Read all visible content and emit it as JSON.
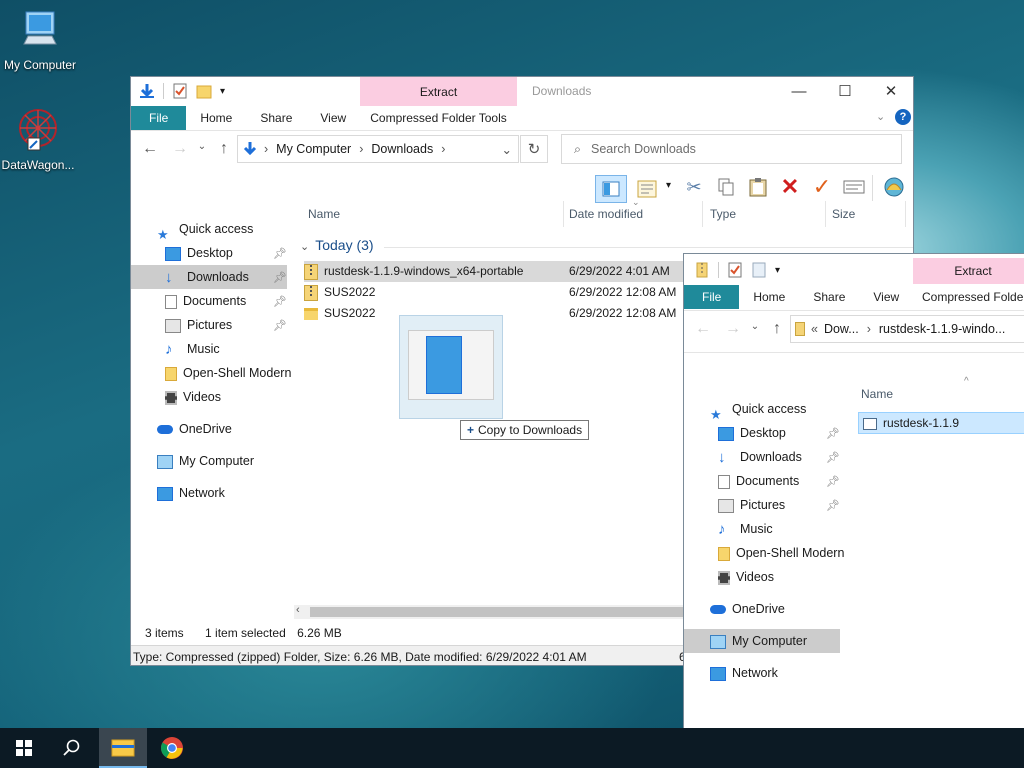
{
  "desktop": {
    "icons": [
      {
        "label": "My Computer"
      },
      {
        "label": "DataWagon..."
      }
    ]
  },
  "main_window": {
    "title_context": "Extract",
    "title_location": "Downloads",
    "tabs": [
      "File",
      "Home",
      "Share",
      "View"
    ],
    "context_tab": "Compressed Folder Tools",
    "address": {
      "root": "My Computer",
      "current": "Downloads"
    },
    "search_placeholder": "Search Downloads",
    "nav": {
      "quick_access": "Quick access",
      "desktop": "Desktop",
      "downloads": "Downloads",
      "documents": "Documents",
      "pictures": "Pictures",
      "music": "Music",
      "openshell": "Open-Shell Modern",
      "videos": "Videos",
      "onedrive": "OneDrive",
      "mycomputer": "My Computer",
      "network": "Network"
    },
    "columns": [
      "Name",
      "Date modified",
      "Type",
      "Size"
    ],
    "group": "Today (3)",
    "files": [
      {
        "name": "rustdesk-1.1.9-windows_x64-portable",
        "date": "6/29/2022 4:01 AM"
      },
      {
        "name": "SUS2022",
        "date": "6/29/2022 12:08 AM"
      },
      {
        "name": "SUS2022",
        "date": "6/29/2022 12:08 AM"
      }
    ],
    "drag_tooltip": "Copy to Downloads",
    "status": {
      "items": "3 items",
      "selected": "1 item selected",
      "size": "6.26 MB"
    },
    "details_bar": "Type: Compressed (zipped) Folder, Size: 6.26 MB, Date modified: 6/29/2022 4:01 AM",
    "details_bar_overflow": "6"
  },
  "second_window": {
    "title_context": "Extract",
    "tabs": [
      "File",
      "Home",
      "Share",
      "View"
    ],
    "context_tab": "Compressed Folder",
    "address": {
      "prefix": "«",
      "part1": "Dow...",
      "part2": "rustdesk-1.1.9-windo..."
    },
    "column": "Name",
    "file": "rustdesk-1.1.9",
    "nav": {
      "quick_access": "Quick access",
      "desktop": "Desktop",
      "downloads": "Downloads",
      "documents": "Documents",
      "pictures": "Pictures",
      "music": "Music",
      "openshell": "Open-Shell Modern",
      "videos": "Videos",
      "onedrive": "OneDrive",
      "mycomputer": "My Computer",
      "network": "Network"
    }
  },
  "colors": {
    "file_tab": "#1f8a9a",
    "context_tab": "#fbcde1",
    "selection": "#cce8ff",
    "accent": "#0078d7"
  }
}
